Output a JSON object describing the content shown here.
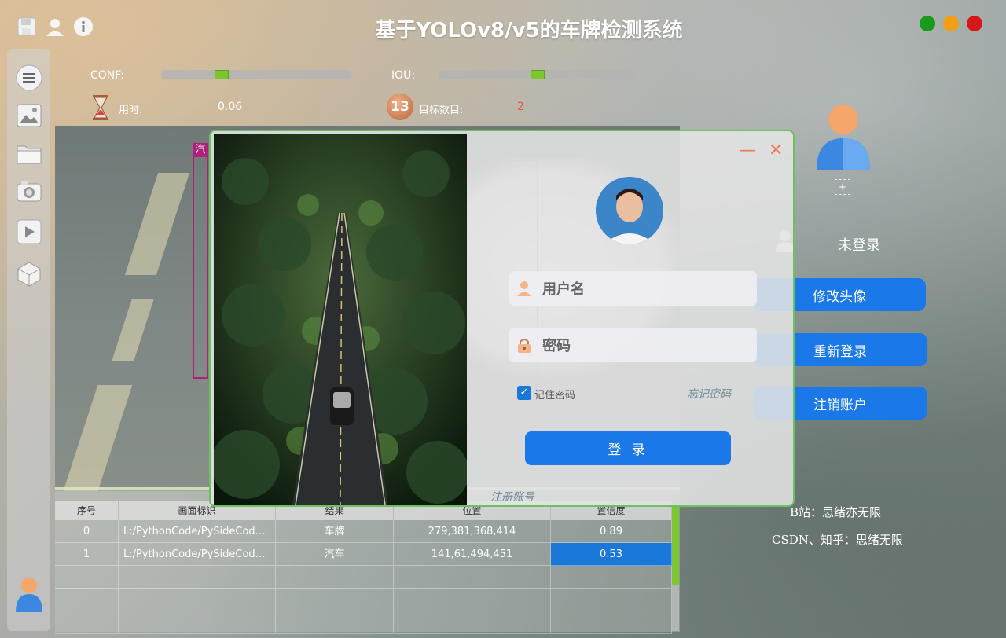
{
  "app": {
    "title": "基于YOLOv8/v5的车牌检测系统"
  },
  "toolbar": {
    "icons": [
      "save-icon",
      "user-icon",
      "info-icon"
    ]
  },
  "window_controls": {
    "colors": [
      "#1a9a1a",
      "#f0a010",
      "#d81818"
    ]
  },
  "sidebar": {
    "icons": [
      "menu-icon",
      "image-icon",
      "folder-icon",
      "camera-icon",
      "video-icon",
      "model-icon",
      "user-avatar-icon"
    ]
  },
  "params": {
    "conf": {
      "label": "CONF:",
      "value": 0.3
    },
    "iou": {
      "label": "IOU:",
      "value": 0.5
    }
  },
  "stats": {
    "time_label": "用时:",
    "time_value": "0.06",
    "count_label": "目标数目:",
    "count_value": "2",
    "count_badge": "13"
  },
  "table": {
    "headers": [
      "序号",
      "画面标识",
      "结果",
      "位置",
      "置信度"
    ],
    "rows": [
      [
        "0",
        "L:/PythonCode/PySideCode/...",
        "车牌",
        "279,381,368,414",
        "0.89"
      ],
      [
        "1",
        "L:/PythonCode/PySideCode/...",
        "汽车",
        "141,61,494,451",
        "0.53"
      ]
    ],
    "empty_rows": 3
  },
  "right_panel": {
    "status": "未登录",
    "buttons": {
      "change_avatar": "修改头像",
      "relogin": "重新登录",
      "logout": "注销账户"
    },
    "plus": "+",
    "credit_bilibili": "B站：思绪亦无限",
    "credit_csdn": "CSDN、知乎：思绪无限"
  },
  "login_dialog": {
    "username_placeholder": "用户名",
    "password_placeholder": "密码",
    "remember_label": "记住密码",
    "remember_checked": true,
    "forgot_label": "忘记密码",
    "login_button": "登 录",
    "register_link": "注册账号",
    "minimize": "—",
    "close": "✕"
  },
  "video_overlay_label": "汽"
}
